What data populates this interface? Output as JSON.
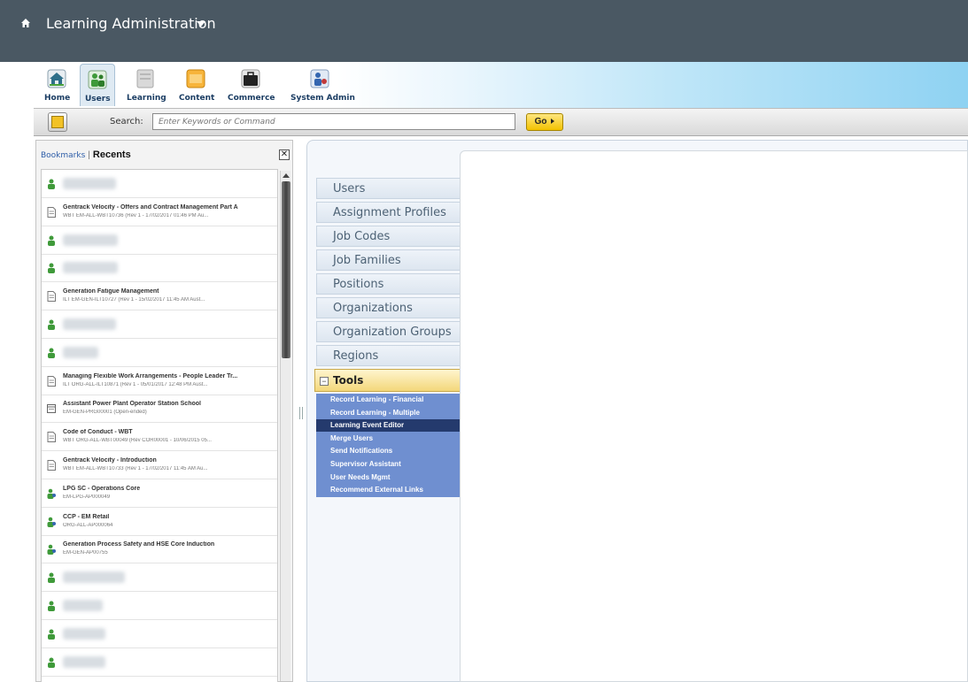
{
  "header": {
    "title": "Learning Administration"
  },
  "nav_tabs": [
    {
      "label": "Home",
      "icon": "house-icon"
    },
    {
      "label": "Users",
      "icon": "users-icon"
    },
    {
      "label": "Learning",
      "icon": "learning-icon"
    },
    {
      "label": "Content",
      "icon": "folder-icon"
    },
    {
      "label": "Commerce",
      "icon": "briefcase-icon"
    },
    {
      "label": "System Admin",
      "icon": "system-admin-icon"
    }
  ],
  "search": {
    "label": "Search:",
    "placeholder": "Enter Keywords or Command",
    "go_label": "Go"
  },
  "left_panel": {
    "tab_bookmarks": "Bookmarks",
    "tab_recents": "Recents",
    "close_glyph": "✕",
    "items": [
      {
        "kind": "user"
      },
      {
        "kind": "doc",
        "title": "Gentrack Velocity - Offers and Contract Management Part A",
        "sub": "WBT EM-ALL-WBT10736 (Rev 1 - 17/02/2017 01:46 PM Au..."
      },
      {
        "kind": "user"
      },
      {
        "kind": "user"
      },
      {
        "kind": "doc",
        "title": "Generation Fatigue Management",
        "sub": "ILT EM-GEN-ILT10727 (Rev 1 - 15/02/2017 11:45 AM Aust..."
      },
      {
        "kind": "user"
      },
      {
        "kind": "user"
      },
      {
        "kind": "doc",
        "title": "Managing Flexible Work Arrangements - People Leader Tr...",
        "sub": "ILT ORG-ALL-ILT10871 (Rev 1 - 05/01/2017 12:48 PM Aust..."
      },
      {
        "kind": "program",
        "title": "Assistant Power Plant Operator Station School",
        "sub": "EM-GEN-PRG00001 (Open-ended)"
      },
      {
        "kind": "doc",
        "title": "Code of Conduct - WBT",
        "sub": "WBT ORG-ALL-WBT00049 (Rev COR00001 - 10/06/2015 05..."
      },
      {
        "kind": "doc",
        "title": "Gentrack Velocity - Introduction",
        "sub": "WBT EM-ALL-WBT10733 (Rev 1 - 17/02/2017 11:45 AM Au..."
      },
      {
        "kind": "profile",
        "title": "LPG SC - Operations Core",
        "sub": "EM-LPG-AP000049"
      },
      {
        "kind": "profile",
        "title": "CCP - EM Retail",
        "sub": "ORG-ALL-AP000064"
      },
      {
        "kind": "profile",
        "title": "Generation Process Safety and HSE Core Induction",
        "sub": "EM-GEN-AP00755"
      },
      {
        "kind": "user"
      },
      {
        "kind": "user"
      },
      {
        "kind": "user"
      },
      {
        "kind": "user"
      }
    ]
  },
  "middle_nav": {
    "items": [
      "Users",
      "Assignment Profiles",
      "Job Codes",
      "Job Families",
      "Positions",
      "Organizations",
      "Organization Groups",
      "Regions"
    ],
    "tools_label": "Tools",
    "tools_toggle": "−",
    "tools_links": [
      "Record Learning - Financial",
      "Record Learning - Multiple",
      "Learning Event Editor",
      "Merge Users",
      "Send Notifications",
      "Supervisor Assistant",
      "User Needs Mgmt",
      "Recommend External Links"
    ],
    "tools_selected_index": 2
  },
  "colors": {
    "header_bg": "#4a5863",
    "tools_bg": "#6f8fd0",
    "tools_selected_bg": "#243a6d",
    "go_button": "#f2c200",
    "user_icon": "#3f9a3a"
  }
}
